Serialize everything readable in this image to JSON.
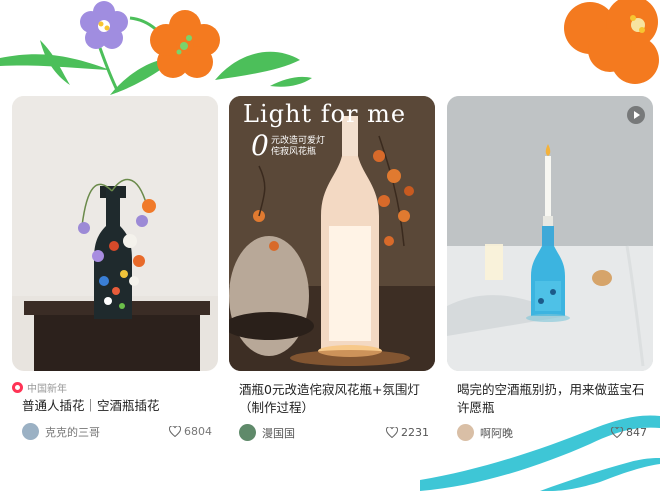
{
  "cards": [
    {
      "tag": "中国新年",
      "title": "普通人插花｜空酒瓶插花",
      "author": "克克的三哥",
      "likes": "6804"
    },
    {
      "overlay_title": "Light for me",
      "overlay_big": "0",
      "overlay_sub1": "元改造可爱灯",
      "overlay_sub2": "侘寂风花瓶",
      "title1": "酒瓶0元改造侘寂风花瓶+氛围灯",
      "title2": "（制作过程）",
      "author": "漫国国",
      "likes": "2231"
    },
    {
      "title1": "喝完的空酒瓶别扔，用来做蓝宝石",
      "title2": "许愿瓶",
      "author": "啊阿晚",
      "likes": "847"
    }
  ],
  "colors": {
    "tag_red": "#ff3355",
    "orange_flower": "#f47a1f",
    "purple_flower": "#a08de0",
    "leaf_green": "#4cbf5a",
    "wave_cyan": "#3ec6d6"
  },
  "icons": [
    "heart-icon",
    "play-icon",
    "flower-icon",
    "leaf-icon",
    "wave-icon"
  ]
}
